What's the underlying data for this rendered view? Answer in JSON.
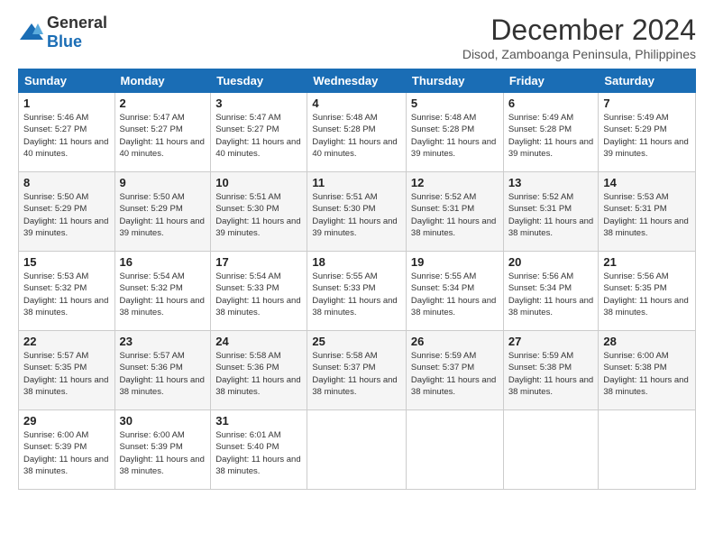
{
  "logo": {
    "general": "General",
    "blue": "Blue"
  },
  "title": "December 2024",
  "subtitle": "Disod, Zamboanga Peninsula, Philippines",
  "headers": [
    "Sunday",
    "Monday",
    "Tuesday",
    "Wednesday",
    "Thursday",
    "Friday",
    "Saturday"
  ],
  "weeks": [
    [
      {
        "day": "1",
        "sunrise": "5:46 AM",
        "sunset": "5:27 PM",
        "daylight": "11 hours and 40 minutes."
      },
      {
        "day": "2",
        "sunrise": "5:47 AM",
        "sunset": "5:27 PM",
        "daylight": "11 hours and 40 minutes."
      },
      {
        "day": "3",
        "sunrise": "5:47 AM",
        "sunset": "5:27 PM",
        "daylight": "11 hours and 40 minutes."
      },
      {
        "day": "4",
        "sunrise": "5:48 AM",
        "sunset": "5:28 PM",
        "daylight": "11 hours and 40 minutes."
      },
      {
        "day": "5",
        "sunrise": "5:48 AM",
        "sunset": "5:28 PM",
        "daylight": "11 hours and 39 minutes."
      },
      {
        "day": "6",
        "sunrise": "5:49 AM",
        "sunset": "5:28 PM",
        "daylight": "11 hours and 39 minutes."
      },
      {
        "day": "7",
        "sunrise": "5:49 AM",
        "sunset": "5:29 PM",
        "daylight": "11 hours and 39 minutes."
      }
    ],
    [
      {
        "day": "8",
        "sunrise": "5:50 AM",
        "sunset": "5:29 PM",
        "daylight": "11 hours and 39 minutes."
      },
      {
        "day": "9",
        "sunrise": "5:50 AM",
        "sunset": "5:29 PM",
        "daylight": "11 hours and 39 minutes."
      },
      {
        "day": "10",
        "sunrise": "5:51 AM",
        "sunset": "5:30 PM",
        "daylight": "11 hours and 39 minutes."
      },
      {
        "day": "11",
        "sunrise": "5:51 AM",
        "sunset": "5:30 PM",
        "daylight": "11 hours and 39 minutes."
      },
      {
        "day": "12",
        "sunrise": "5:52 AM",
        "sunset": "5:31 PM",
        "daylight": "11 hours and 38 minutes."
      },
      {
        "day": "13",
        "sunrise": "5:52 AM",
        "sunset": "5:31 PM",
        "daylight": "11 hours and 38 minutes."
      },
      {
        "day": "14",
        "sunrise": "5:53 AM",
        "sunset": "5:31 PM",
        "daylight": "11 hours and 38 minutes."
      }
    ],
    [
      {
        "day": "15",
        "sunrise": "5:53 AM",
        "sunset": "5:32 PM",
        "daylight": "11 hours and 38 minutes."
      },
      {
        "day": "16",
        "sunrise": "5:54 AM",
        "sunset": "5:32 PM",
        "daylight": "11 hours and 38 minutes."
      },
      {
        "day": "17",
        "sunrise": "5:54 AM",
        "sunset": "5:33 PM",
        "daylight": "11 hours and 38 minutes."
      },
      {
        "day": "18",
        "sunrise": "5:55 AM",
        "sunset": "5:33 PM",
        "daylight": "11 hours and 38 minutes."
      },
      {
        "day": "19",
        "sunrise": "5:55 AM",
        "sunset": "5:34 PM",
        "daylight": "11 hours and 38 minutes."
      },
      {
        "day": "20",
        "sunrise": "5:56 AM",
        "sunset": "5:34 PM",
        "daylight": "11 hours and 38 minutes."
      },
      {
        "day": "21",
        "sunrise": "5:56 AM",
        "sunset": "5:35 PM",
        "daylight": "11 hours and 38 minutes."
      }
    ],
    [
      {
        "day": "22",
        "sunrise": "5:57 AM",
        "sunset": "5:35 PM",
        "daylight": "11 hours and 38 minutes."
      },
      {
        "day": "23",
        "sunrise": "5:57 AM",
        "sunset": "5:36 PM",
        "daylight": "11 hours and 38 minutes."
      },
      {
        "day": "24",
        "sunrise": "5:58 AM",
        "sunset": "5:36 PM",
        "daylight": "11 hours and 38 minutes."
      },
      {
        "day": "25",
        "sunrise": "5:58 AM",
        "sunset": "5:37 PM",
        "daylight": "11 hours and 38 minutes."
      },
      {
        "day": "26",
        "sunrise": "5:59 AM",
        "sunset": "5:37 PM",
        "daylight": "11 hours and 38 minutes."
      },
      {
        "day": "27",
        "sunrise": "5:59 AM",
        "sunset": "5:38 PM",
        "daylight": "11 hours and 38 minutes."
      },
      {
        "day": "28",
        "sunrise": "6:00 AM",
        "sunset": "5:38 PM",
        "daylight": "11 hours and 38 minutes."
      }
    ],
    [
      {
        "day": "29",
        "sunrise": "6:00 AM",
        "sunset": "5:39 PM",
        "daylight": "11 hours and 38 minutes."
      },
      {
        "day": "30",
        "sunrise": "6:00 AM",
        "sunset": "5:39 PM",
        "daylight": "11 hours and 38 minutes."
      },
      {
        "day": "31",
        "sunrise": "6:01 AM",
        "sunset": "5:40 PM",
        "daylight": "11 hours and 38 minutes."
      },
      null,
      null,
      null,
      null
    ]
  ]
}
